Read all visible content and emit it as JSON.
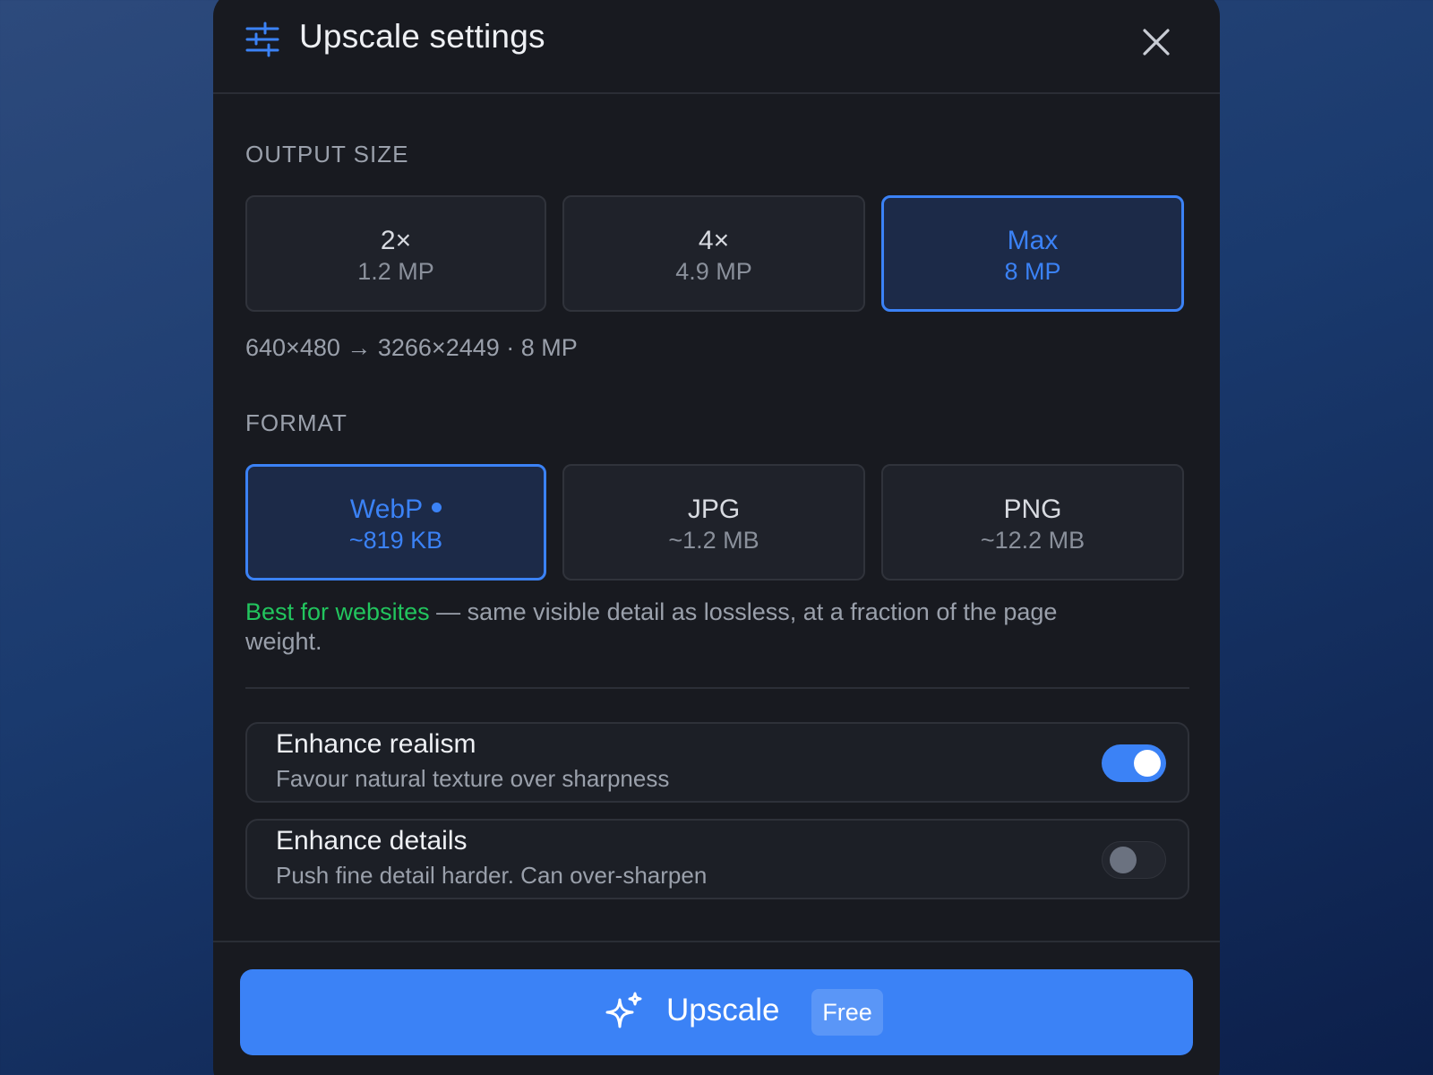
{
  "header": {
    "title": "Upscale settings",
    "settings_icon": "sliders-icon",
    "close_icon": "close-icon"
  },
  "output_size": {
    "label": "OUTPUT SIZE",
    "options": [
      {
        "main": "2×",
        "sub": "1.2 MP",
        "selected": false
      },
      {
        "main": "4×",
        "sub": "4.9 MP",
        "selected": false
      },
      {
        "main": "Max",
        "sub": "8 MP",
        "selected": true
      }
    ],
    "resolution_text": "640×480 → 3266×2449 · 8 MP"
  },
  "format": {
    "label": "FORMAT",
    "options": [
      {
        "main": "WebP",
        "sub": "~819 KB",
        "selected": true,
        "recommended_dot": true
      },
      {
        "main": "JPG",
        "sub": "~1.2 MB",
        "selected": false
      },
      {
        "main": "PNG",
        "sub": "~12.2 MB",
        "selected": false
      }
    ],
    "note_highlight": "Best for websites",
    "note_rest": " — same visible detail as lossless, at a fraction of the page weight."
  },
  "toggles": [
    {
      "title": "Enhance realism",
      "subtitle": "Favour natural texture over sharpness",
      "on": true
    },
    {
      "title": "Enhance details",
      "subtitle": "Push fine detail harder. Can over-sharpen",
      "on": false
    }
  ],
  "action": {
    "label": "Upscale",
    "badge": "Free",
    "icon": "sparkle-icon"
  },
  "colors": {
    "accent": "#3b82f6",
    "success": "#22c55e",
    "panel": "#181a20"
  }
}
